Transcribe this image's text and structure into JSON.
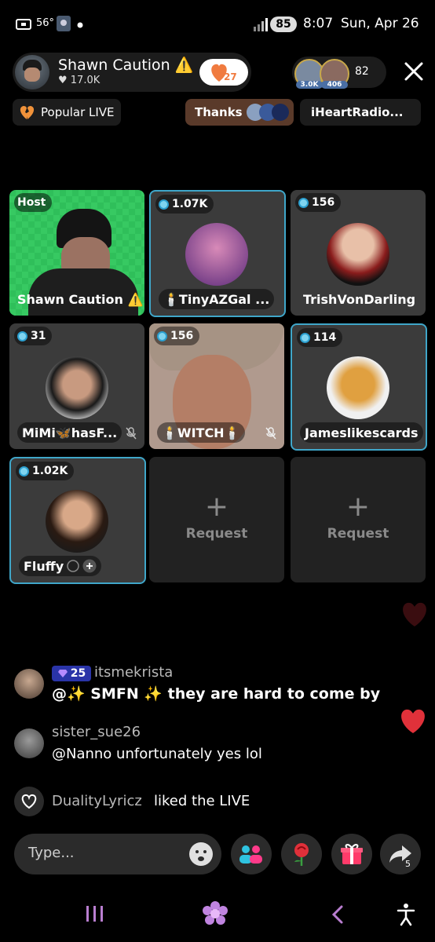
{
  "status_bar": {
    "temperature": "56°",
    "battery": "85",
    "time": "8:07",
    "date": "Sun, Apr 26"
  },
  "host": {
    "name": "Shawn Caution ⚠️",
    "likes": "♥ 17.0K",
    "follow_count": "27"
  },
  "viewers": {
    "avatar_badges": [
      "3.0K",
      "406"
    ],
    "count": "82"
  },
  "chips": {
    "popular": "Popular LIVE",
    "thanks": "Thanks",
    "iheart": "iHeartRadio..."
  },
  "grid": {
    "tiles": [
      {
        "badge": "Host",
        "name": "Shawn Caution ⚠️"
      },
      {
        "badge": "1.07K",
        "name": "🕯️TinyAZGal ..."
      },
      {
        "badge": "156",
        "name": "TrishVonDarling"
      },
      {
        "badge": "31",
        "name": "MiMi🦋hasF..."
      },
      {
        "badge": "156",
        "name": "🕯️WITCH🕯️"
      },
      {
        "badge": "114",
        "name": "Jameslikescards"
      },
      {
        "badge": "1.02K",
        "name": "Fluffy"
      }
    ],
    "request_label": "Request"
  },
  "chat": {
    "messages": [
      {
        "level": "25",
        "user": "itsmekrista",
        "text": "@✨ SMFN ✨ they are hard to come by"
      },
      {
        "user": "sister_sue26",
        "text": "@Nanno unfortunately yes lol"
      }
    ],
    "like_event": {
      "user": "DualityLyricz",
      "text": "liked the LIVE"
    }
  },
  "composer": {
    "placeholder": "Type...",
    "share_count": "5"
  },
  "colors": {
    "accent_red": "#e0313a",
    "selected_border": "#3fa6c9",
    "host_tile_green": "#2fbf5a"
  }
}
